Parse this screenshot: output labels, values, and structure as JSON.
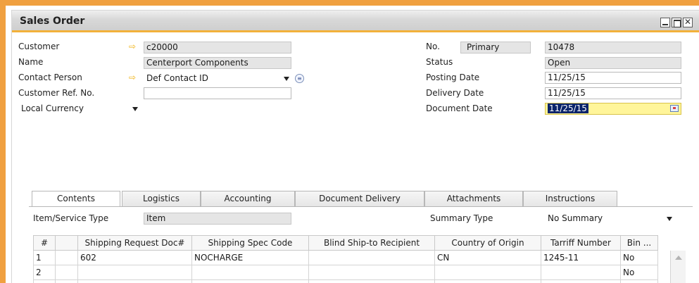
{
  "window": {
    "title": "Sales Order"
  },
  "header": {
    "customer": {
      "label": "Customer",
      "value": "c20000"
    },
    "name": {
      "label": "Name",
      "value": "Centerport Components"
    },
    "contact": {
      "label": "Contact Person",
      "value": "Def Contact ID"
    },
    "customer_ref": {
      "label": "Customer Ref. No.",
      "value": ""
    },
    "currency": {
      "value": "Local Currency"
    },
    "no": {
      "label": "No.",
      "series": "Primary",
      "value": "10478"
    },
    "status": {
      "label": "Status",
      "value": "Open"
    },
    "posting_date": {
      "label": "Posting Date",
      "value": "11/25/15"
    },
    "delivery_date": {
      "label": "Delivery Date",
      "value": "11/25/15"
    },
    "document_date": {
      "label": "Document Date",
      "value": "11/25/15"
    }
  },
  "tabs": [
    {
      "label": "Contents",
      "active": true
    },
    {
      "label": "Logistics"
    },
    {
      "label": "Accounting"
    },
    {
      "label": "Document Delivery"
    },
    {
      "label": "Attachments"
    },
    {
      "label": "Instructions"
    }
  ],
  "contents": {
    "item_service_type": {
      "label": "Item/Service Type",
      "value": "Item"
    },
    "summary_type": {
      "label": "Summary Type",
      "value": "No Summary"
    },
    "columns": [
      "#",
      "",
      "Shipping Request Doc#",
      "Shipping Spec Code",
      "Blind Ship-to Recipient",
      "Country of Origin",
      "Tarriff Number",
      "Bin ..."
    ],
    "rows": [
      [
        "1",
        "",
        "602",
        "NOCHARGE",
        "",
        "CN",
        "1245-11",
        "No"
      ],
      [
        "2",
        "",
        "",
        "",
        "",
        "",
        "",
        "No"
      ],
      [
        "",
        "",
        "",
        "",
        "",
        "",
        "",
        ""
      ]
    ]
  },
  "colors": {
    "accent": "#f0a040",
    "highlight": "#fff59a",
    "selection": "#0a246a"
  }
}
